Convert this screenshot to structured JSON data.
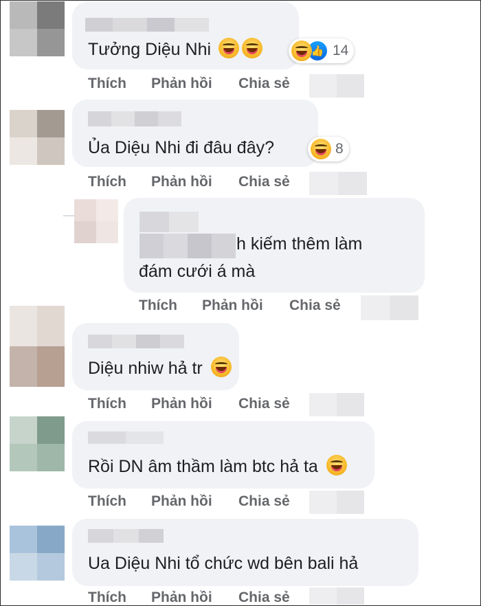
{
  "actions": {
    "like": "Thích",
    "reply": "Phản hồi",
    "share": "Chia sẻ"
  },
  "comments": [
    {
      "text": "Tưởng Diệu Nhi",
      "emojis": 2,
      "reaction_count": "14",
      "reaction_types": [
        "laughing-emoji",
        "like-icon"
      ]
    },
    {
      "text": "Ủa Diệu Nhi đi đâu đây?",
      "reaction_count": "8",
      "reaction_types": [
        "laughing-emoji"
      ]
    },
    {
      "text_line1": "h kiếm thêm làm",
      "text_line2": "đám cưới á mà"
    },
    {
      "text": "Diệu nhiw hả tr",
      "emojis": 1
    },
    {
      "name_partial": "Tường vi",
      "text": "Rồi DN âm thầm làm btc hả ta",
      "emojis": 1
    },
    {
      "text": "Ua Diệu Nhi tổ chức wd bên bali hả"
    }
  ]
}
